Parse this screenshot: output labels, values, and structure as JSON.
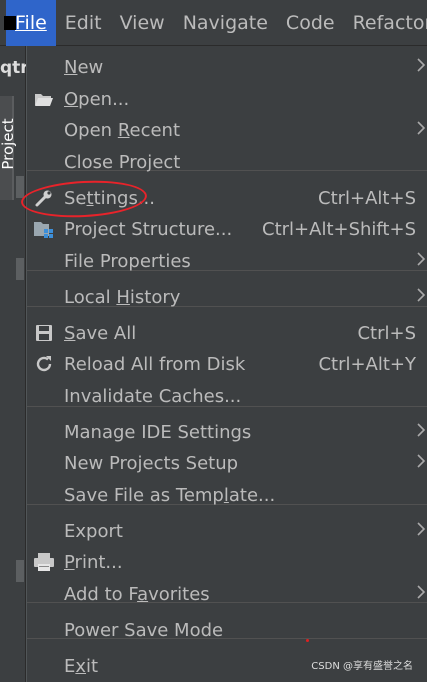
{
  "menubar": {
    "items": [
      {
        "label": "File",
        "mnemonic_index": 0
      },
      {
        "label": "Edit",
        "mnemonic_index": 0
      },
      {
        "label": "View",
        "mnemonic_index": 0
      },
      {
        "label": "Navigate",
        "mnemonic_index": 0
      },
      {
        "label": "Code",
        "mnemonic_index": 0
      },
      {
        "label": "Refactor",
        "mnemonic_index": 0
      }
    ],
    "active": "File"
  },
  "sidebar": {
    "project_header": "qtr",
    "project_tab": "Project"
  },
  "file_menu": {
    "items": [
      {
        "pre": "",
        "mn": "N",
        "post": "ew",
        "shortcut": "",
        "submenu": true,
        "icon": ""
      },
      {
        "pre": "",
        "mn": "O",
        "post": "pen...",
        "shortcut": "",
        "submenu": false,
        "icon": "folder-open-icon"
      },
      {
        "pre": "Open ",
        "mn": "R",
        "post": "ecent",
        "shortcut": "",
        "submenu": true,
        "icon": ""
      },
      {
        "pre": "Close Project",
        "mn": "",
        "post": "",
        "shortcut": "",
        "submenu": false,
        "icon": ""
      },
      {
        "pre": "Se",
        "mn": "t",
        "post": "tings...",
        "shortcut": "Ctrl+Alt+S",
        "submenu": false,
        "icon": "wrench-icon"
      },
      {
        "pre": "Project Structure...",
        "mn": "",
        "post": "",
        "shortcut": "Ctrl+Alt+Shift+S",
        "submenu": false,
        "icon": "project-structure-icon"
      },
      {
        "pre": "File Properties",
        "mn": "",
        "post": "",
        "shortcut": "",
        "submenu": true,
        "icon": ""
      },
      {
        "pre": "Local ",
        "mn": "H",
        "post": "istory",
        "shortcut": "",
        "submenu": true,
        "icon": ""
      },
      {
        "pre": "",
        "mn": "S",
        "post": "ave All",
        "shortcut": "Ctrl+S",
        "submenu": false,
        "icon": "save-icon"
      },
      {
        "pre": "Reload All from Disk",
        "mn": "",
        "post": "",
        "shortcut": "Ctrl+Alt+Y",
        "submenu": false,
        "icon": "reload-icon"
      },
      {
        "pre": "Invalidate Caches...",
        "mn": "",
        "post": "",
        "shortcut": "",
        "submenu": false,
        "icon": ""
      },
      {
        "pre": "Manage IDE Settings",
        "mn": "",
        "post": "",
        "shortcut": "",
        "submenu": true,
        "icon": ""
      },
      {
        "pre": "New Projects Setup",
        "mn": "",
        "post": "",
        "shortcut": "",
        "submenu": true,
        "icon": ""
      },
      {
        "pre": "Save File as Temp",
        "mn": "l",
        "post": "ate...",
        "shortcut": "",
        "submenu": false,
        "icon": ""
      },
      {
        "pre": "Export",
        "mn": "",
        "post": "",
        "shortcut": "",
        "submenu": true,
        "icon": ""
      },
      {
        "pre": "",
        "mn": "P",
        "post": "rint...",
        "shortcut": "",
        "submenu": false,
        "icon": "print-icon"
      },
      {
        "pre": "Add to F",
        "mn": "a",
        "post": "vorites",
        "shortcut": "",
        "submenu": true,
        "icon": ""
      },
      {
        "pre": "Power Save Mode",
        "mn": "",
        "post": "",
        "shortcut": "",
        "submenu": false,
        "icon": ""
      },
      {
        "pre": "E",
        "mn": "x",
        "post": "it",
        "shortcut": "",
        "submenu": false,
        "icon": ""
      }
    ]
  },
  "watermark": "CSDN @享有盛誉之名",
  "colors": {
    "menu_bg": "#3c3f41",
    "active_menu_bg": "#2f65ca",
    "text": "#bbbbbb",
    "annotation_red": "#e8232a"
  }
}
